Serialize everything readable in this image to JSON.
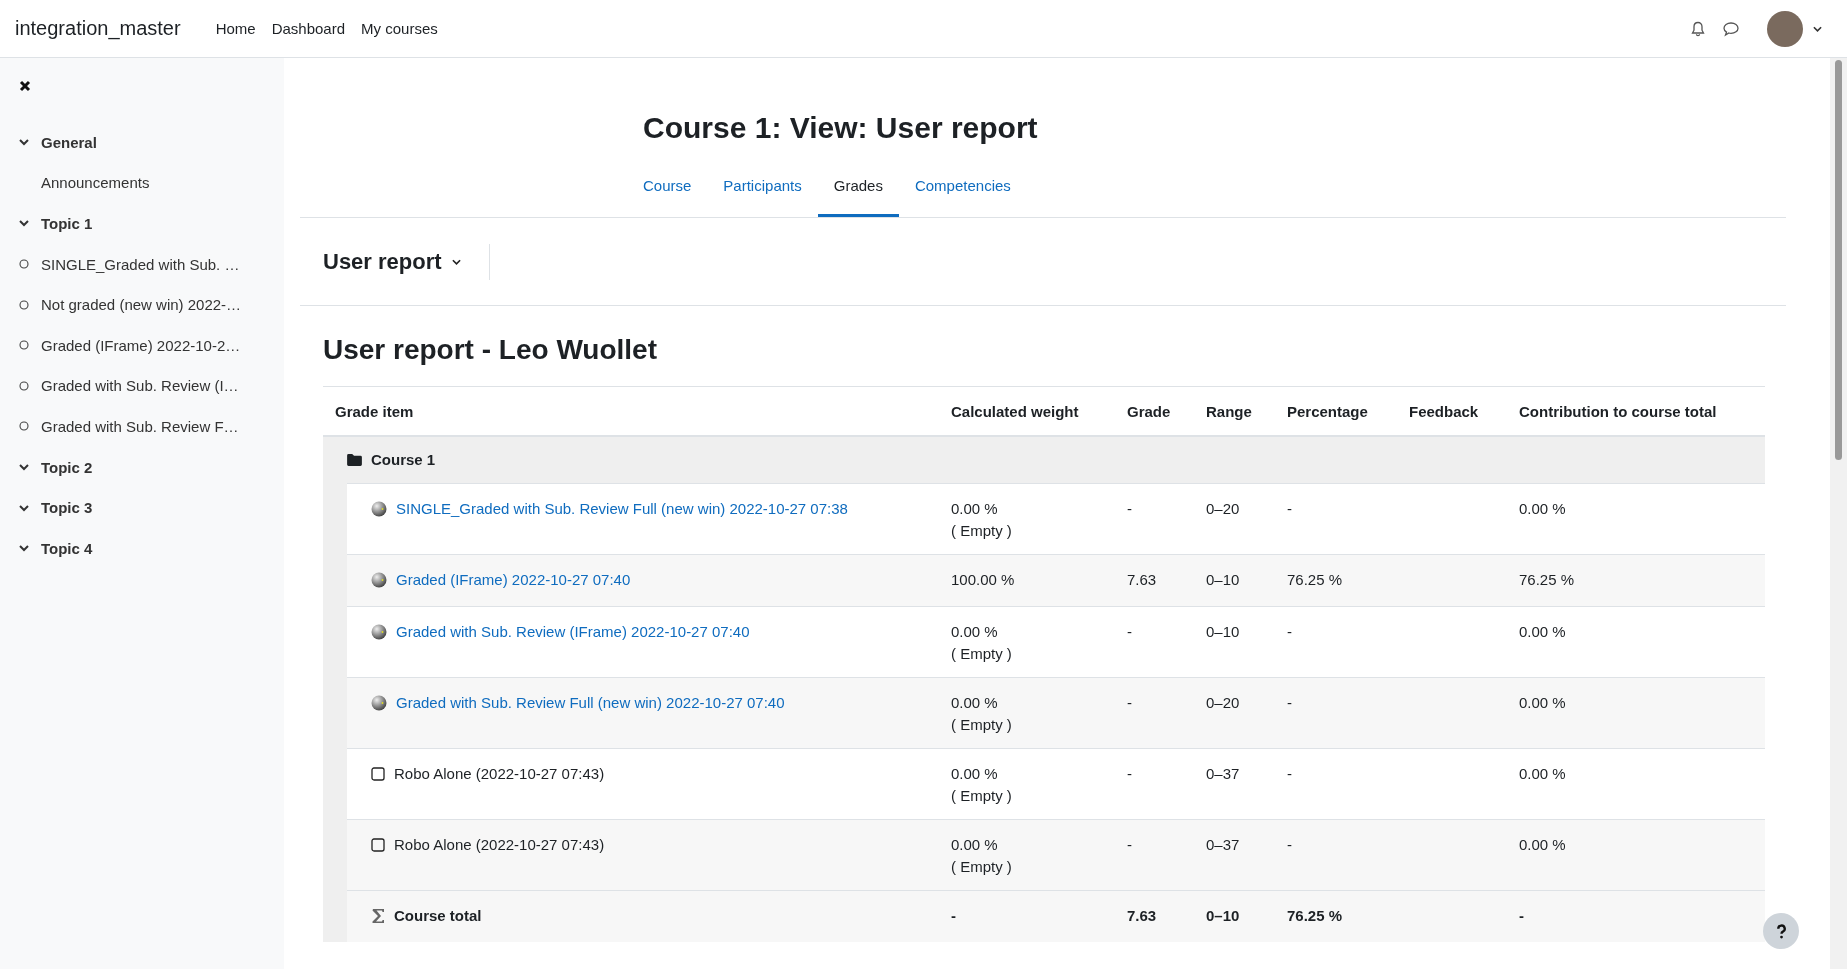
{
  "navbar": {
    "site_name": "integration_master",
    "links": [
      "Home",
      "Dashboard",
      "My courses"
    ]
  },
  "sidebar": {
    "items": [
      {
        "kind": "section",
        "label": "General",
        "expanded": true,
        "children": [
          {
            "kind": "page",
            "label": "Announcements"
          }
        ]
      },
      {
        "kind": "section",
        "label": "Topic 1",
        "expanded": true,
        "children": [
          {
            "kind": "activity",
            "label": "SINGLE_Graded with Sub. …"
          },
          {
            "kind": "activity",
            "label": "Not graded (new win) 2022-…"
          },
          {
            "kind": "activity",
            "label": "Graded (IFrame) 2022-10-2…"
          },
          {
            "kind": "activity",
            "label": "Graded with Sub. Review (I…"
          },
          {
            "kind": "activity",
            "label": "Graded with Sub. Review F…"
          }
        ]
      },
      {
        "kind": "section",
        "label": "Topic 2",
        "expanded": true
      },
      {
        "kind": "section",
        "label": "Topic 3",
        "expanded": true
      },
      {
        "kind": "section",
        "label": "Topic 4",
        "expanded": true
      }
    ]
  },
  "page_title": "Course 1: View: User report",
  "tabs": [
    {
      "label": "Course",
      "selected": false
    },
    {
      "label": "Participants",
      "selected": false
    },
    {
      "label": "Grades",
      "selected": true
    },
    {
      "label": "Competencies",
      "selected": false
    }
  ],
  "report_selector": "User report",
  "report_title": "User report - Leo Wuollet",
  "table": {
    "columns": [
      "Grade item",
      "Calculated weight",
      "Grade",
      "Range",
      "Percentage",
      "Feedback",
      "Contribution to course total"
    ],
    "category": "Course 1",
    "rows": [
      {
        "kind": "activity",
        "item": "SINGLE_Graded with Sub. Review Full (new win) 2022-10-27 07:38",
        "weight": "0.00 %",
        "weight_note": "( Empty )",
        "grade": "-",
        "range": "0–20",
        "percentage": "-",
        "contribution": "0.00 %"
      },
      {
        "kind": "activity",
        "item": "Graded (IFrame) 2022-10-27 07:40",
        "weight": "100.00 %",
        "grade": "7.63",
        "range": "0–10",
        "percentage": "76.25 %",
        "contribution": "76.25 %"
      },
      {
        "kind": "activity",
        "item": "Graded with Sub. Review (IFrame) 2022-10-27 07:40",
        "weight": "0.00 %",
        "weight_note": "( Empty )",
        "grade": "-",
        "range": "0–10",
        "percentage": "-",
        "contribution": "0.00 %"
      },
      {
        "kind": "activity",
        "item": "Graded with Sub. Review Full (new win) 2022-10-27 07:40",
        "weight": "0.00 %",
        "weight_note": "( Empty )",
        "grade": "-",
        "range": "0–20",
        "percentage": "-",
        "contribution": "0.00 %"
      },
      {
        "kind": "manual",
        "item": "Robo Alone (2022-10-27 07:43)",
        "weight": "0.00 %",
        "weight_note": "( Empty )",
        "grade": "-",
        "range": "0–37",
        "percentage": "-",
        "contribution": "0.00 %"
      },
      {
        "kind": "manual",
        "item": "Robo Alone (2022-10-27 07:43)",
        "weight": "0.00 %",
        "weight_note": "( Empty )",
        "grade": "-",
        "range": "0–37",
        "percentage": "-",
        "contribution": "0.00 %"
      }
    ],
    "total": {
      "item": "Course total",
      "weight": "-",
      "grade": "7.63",
      "range": "0–10",
      "percentage": "76.25 %",
      "contribution": "-"
    }
  }
}
